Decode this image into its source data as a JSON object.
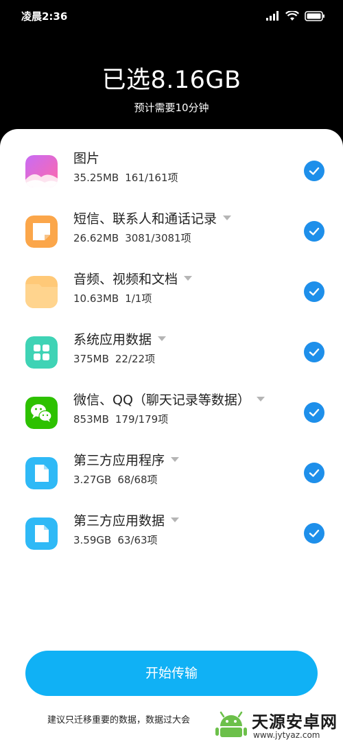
{
  "status_bar": {
    "time": "凌晨2:36",
    "icons": [
      "signal-icon",
      "wifi-icon",
      "battery-icon"
    ]
  },
  "header": {
    "title": "已选8.16GB",
    "subtitle": "预计需要10分钟"
  },
  "items": [
    {
      "title": "图片",
      "size": "35.25MB",
      "count": "161/161项",
      "icon": "gallery-icon",
      "dropdown": false,
      "checked": true
    },
    {
      "title": "短信、联系人和通话记录",
      "size": "26.62MB",
      "count": "3081/3081项",
      "icon": "messages-icon",
      "dropdown": true,
      "checked": true
    },
    {
      "title": "音频、视频和文档",
      "size": "10.63MB",
      "count": "1/1项",
      "icon": "folder-icon",
      "dropdown": true,
      "checked": true
    },
    {
      "title": "系统应用数据",
      "size": "375MB",
      "count": "22/22项",
      "icon": "apps-grid-icon",
      "dropdown": true,
      "checked": true
    },
    {
      "title": "微信、QQ（聊天记录等数据）",
      "size": "853MB",
      "count": "179/179项",
      "icon": "wechat-icon",
      "dropdown": true,
      "checked": true
    },
    {
      "title": "第三方应用程序",
      "size": "3.27GB",
      "count": "68/68项",
      "icon": "file-icon",
      "dropdown": true,
      "checked": true
    },
    {
      "title": "第三方应用数据",
      "size": "3.59GB",
      "count": "63/63项",
      "icon": "file-icon",
      "dropdown": true,
      "checked": true
    }
  ],
  "start_button": {
    "label": "开始传输"
  },
  "footer_note": "建议只迁移重要的数据，数据过大会",
  "watermark": {
    "title": "天源安卓网",
    "url": "www.jytyaz.com"
  },
  "colors": {
    "accent": "#1e8fea",
    "button": "#10b1f5",
    "background_top": "#000000",
    "sheet": "#ffffff"
  }
}
